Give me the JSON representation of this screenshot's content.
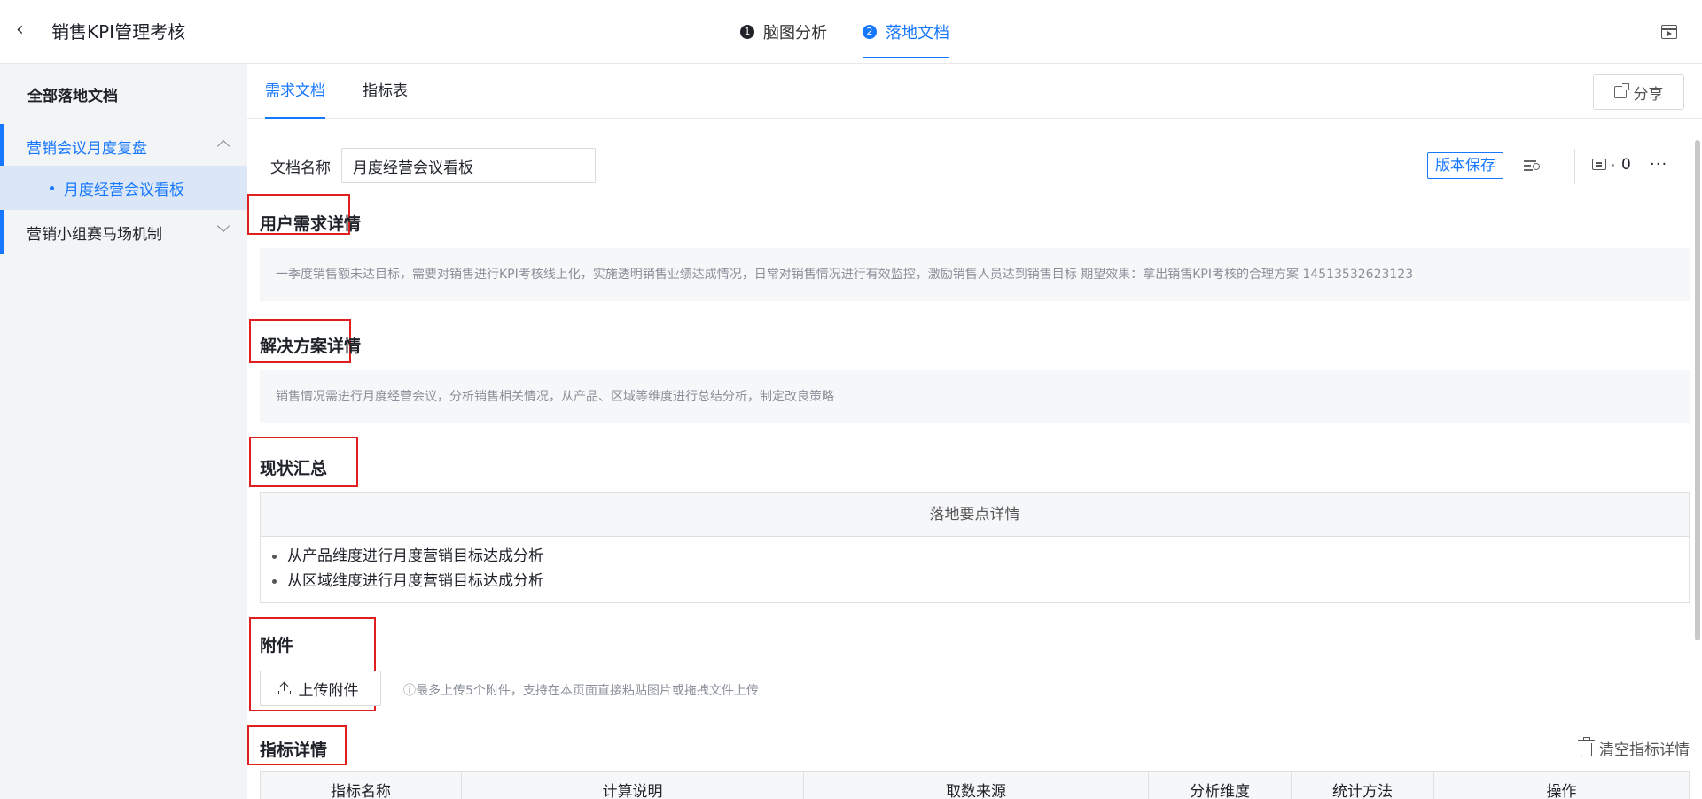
{
  "header": {
    "title": "销售KPI管理考核",
    "steps": [
      {
        "num": "1",
        "label": "脑图分析"
      },
      {
        "num": "2",
        "label": "落地文档"
      }
    ]
  },
  "sidebar": {
    "heading": "全部落地文档",
    "groups": [
      {
        "label": "营销会议月度复盘",
        "items": [
          {
            "label": "月度经营会议看板"
          }
        ]
      },
      {
        "label": "营销小组赛马场机制"
      }
    ]
  },
  "tabs": [
    {
      "label": "需求文档"
    },
    {
      "label": "指标表"
    }
  ],
  "share_label": "分享",
  "doc": {
    "name_label": "文档名称",
    "name_value": "月度经营会议看板",
    "save_version_label": "版本保存",
    "comment_count": "0"
  },
  "sections": {
    "user_need": {
      "title": "用户需求详情",
      "text": "一季度销售额未达目标，需要对销售进行KPI考核线上化，实施透明销售业绩达成情况，日常对销售情况进行有效监控，激励销售人员达到销售目标 期望效果：拿出销售KPI考核的合理方案 14513532623123"
    },
    "solution": {
      "title": "解决方案详情",
      "text": "销售情况需进行月度经营会议，分析销售相关情况，从产品、区域等维度进行总结分析，制定改良策略"
    },
    "status": {
      "title": "现状汇总",
      "table_header": "落地要点详情",
      "items": [
        "从产品维度进行月度营销目标达成分析",
        "从区域维度进行月度营销目标达成分析"
      ]
    },
    "attachment": {
      "title": "附件",
      "upload_label": "上传附件",
      "hint": "ⓘ最多上传5个附件，支持在本页面直接粘贴图片或拖拽文件上传"
    },
    "metrics": {
      "title": "指标详情",
      "clear_label": "清空指标详情",
      "columns": [
        "指标名称",
        "计算说明",
        "取数来源",
        "分析维度",
        "统计方法",
        "操作"
      ]
    }
  }
}
